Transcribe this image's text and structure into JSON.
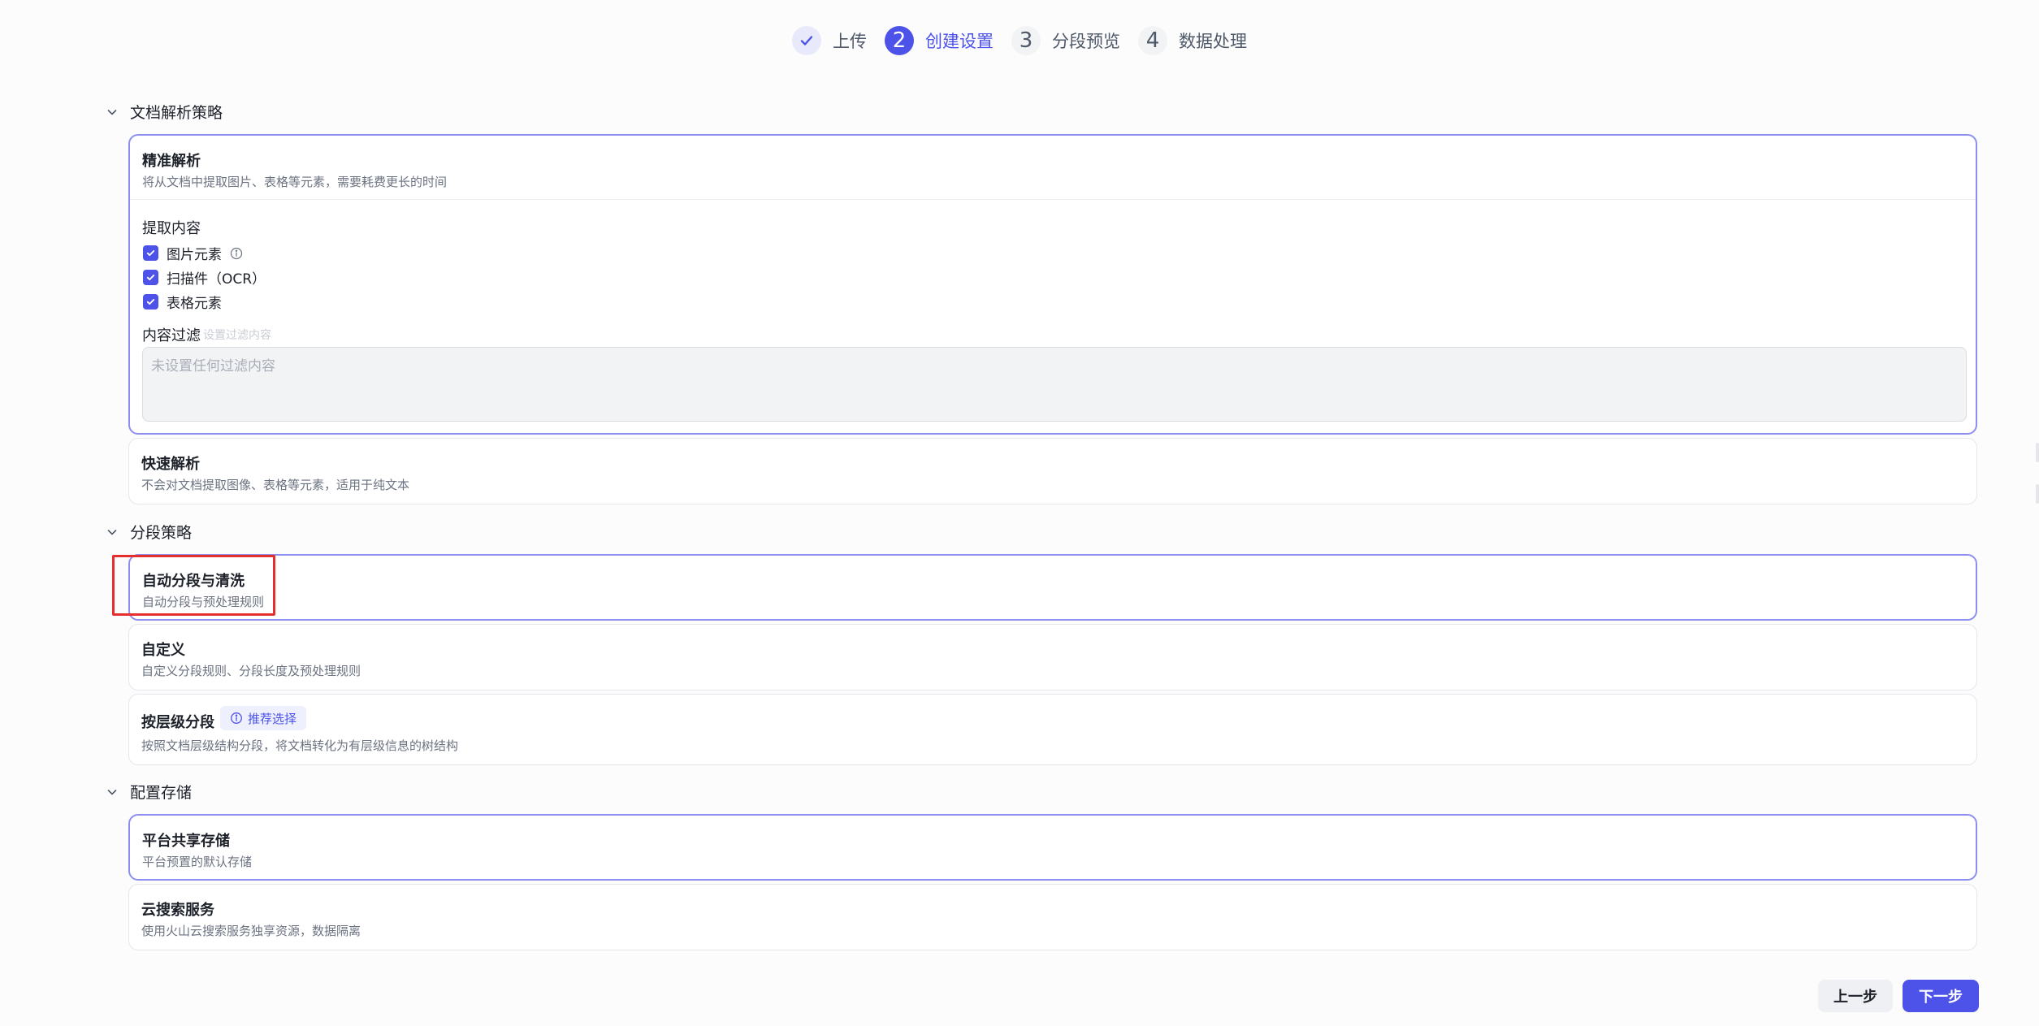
{
  "steps": [
    {
      "number": "",
      "label": "上传",
      "state": "done"
    },
    {
      "number": "2",
      "label": "创建设置",
      "state": "active"
    },
    {
      "number": "3",
      "label": "分段预览",
      "state": "pending"
    },
    {
      "number": "4",
      "label": "数据处理",
      "state": "pending"
    }
  ],
  "parsing": {
    "title": "文档解析策略",
    "precise": {
      "title": "精准解析",
      "desc": "将从文档中提取图片、表格等元素，需要耗费更长的时间",
      "extract_title": "提取内容",
      "options": [
        {
          "label": "图片元素",
          "checked": true
        },
        {
          "label": "扫描件（OCR）",
          "checked": true
        },
        {
          "label": "表格元素",
          "checked": true
        }
      ],
      "filter_label": "内容过滤",
      "filter_hint": "设置过滤内容",
      "filter_placeholder": "未设置任何过滤内容"
    },
    "fast": {
      "title": "快速解析",
      "desc": "不会对文档提取图像、表格等元素，适用于纯文本"
    }
  },
  "segmentation": {
    "title": "分段策略",
    "auto": {
      "title": "自动分段与清洗",
      "desc": "自动分段与预处理规则"
    },
    "custom": {
      "title": "自定义",
      "desc": "自定义分段规则、分段长度及预处理规则"
    },
    "hierarchy": {
      "title": "按层级分段",
      "badge": "推荐选择",
      "desc": "按照文档层级结构分段，将文档转化为有层级信息的树结构"
    }
  },
  "storage": {
    "title": "配置存储",
    "shared": {
      "title": "平台共享存储",
      "desc": "平台预置的默认存储"
    },
    "cloud": {
      "title": "云搜索服务",
      "desc": "使用火山云搜索服务独享资源，数据隔离"
    }
  },
  "footer": {
    "prev_label": "上一步",
    "next_label": "下一步"
  },
  "colors": {
    "accent": "#4d53e8",
    "selected_border": "#8d8ff0",
    "highlight": "#e52e2e"
  }
}
